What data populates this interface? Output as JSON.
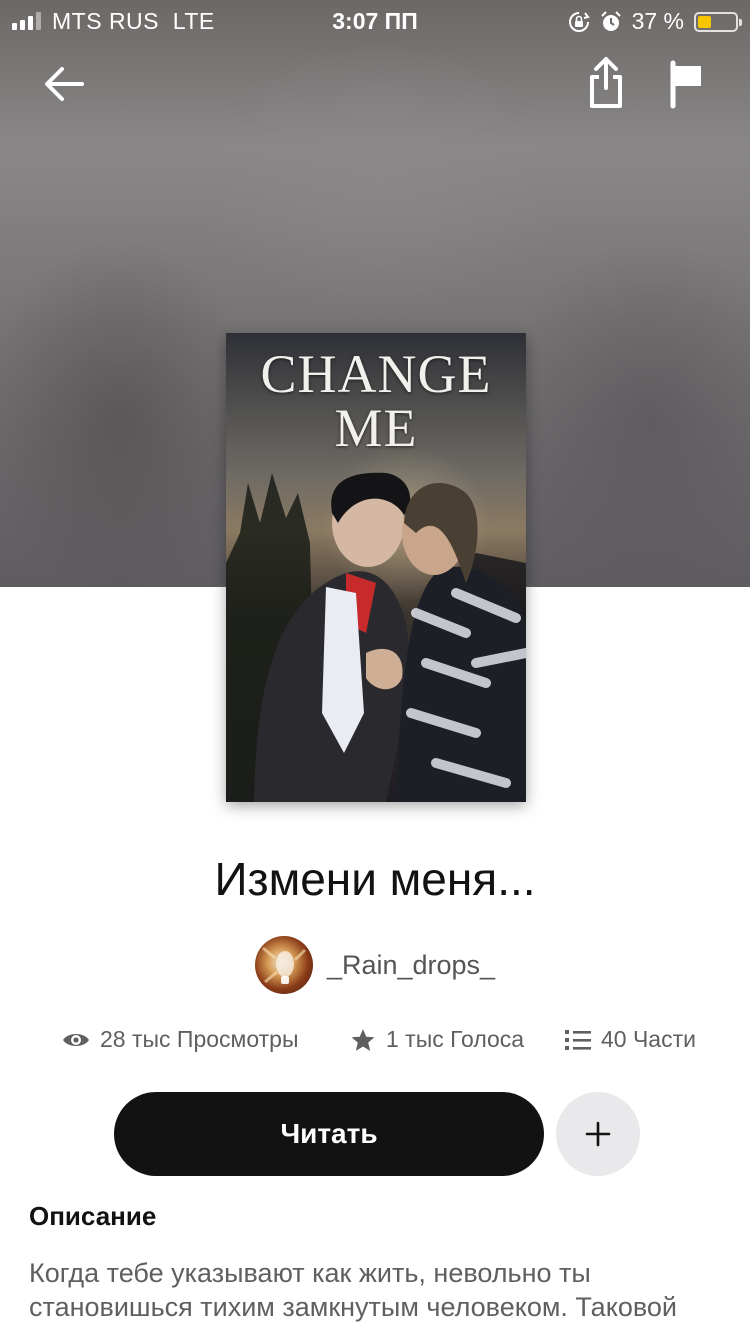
{
  "status_bar": {
    "carrier": "MTS RUS",
    "network": "LTE",
    "time": "3:07 ПП",
    "battery_percent": "37 %",
    "battery_level": 0.37,
    "battery_color": "#f6c500"
  },
  "nav": {
    "back_icon": "arrow-left-icon",
    "share_icon": "share-icon",
    "report_icon": "flag-icon"
  },
  "cover": {
    "title_line1": "CHANGE",
    "title_line2": "ME"
  },
  "story": {
    "title": "Измени меня...",
    "author": "_Rain_drops_"
  },
  "stats": {
    "views": "28 тыс Просмотры",
    "votes": "1 тыс Голоса",
    "parts": "40 Части"
  },
  "actions": {
    "read_label": "Читать",
    "add_icon": "plus-icon"
  },
  "description": {
    "heading": "Описание",
    "text": "Когда тебе указывают как жить, невольно ты становишься тихим замкнутым человеком. Таковой"
  },
  "colors": {
    "primary_button": "#121212",
    "secondary_button": "#e9e8ea",
    "muted_text": "#5f5f5f"
  }
}
